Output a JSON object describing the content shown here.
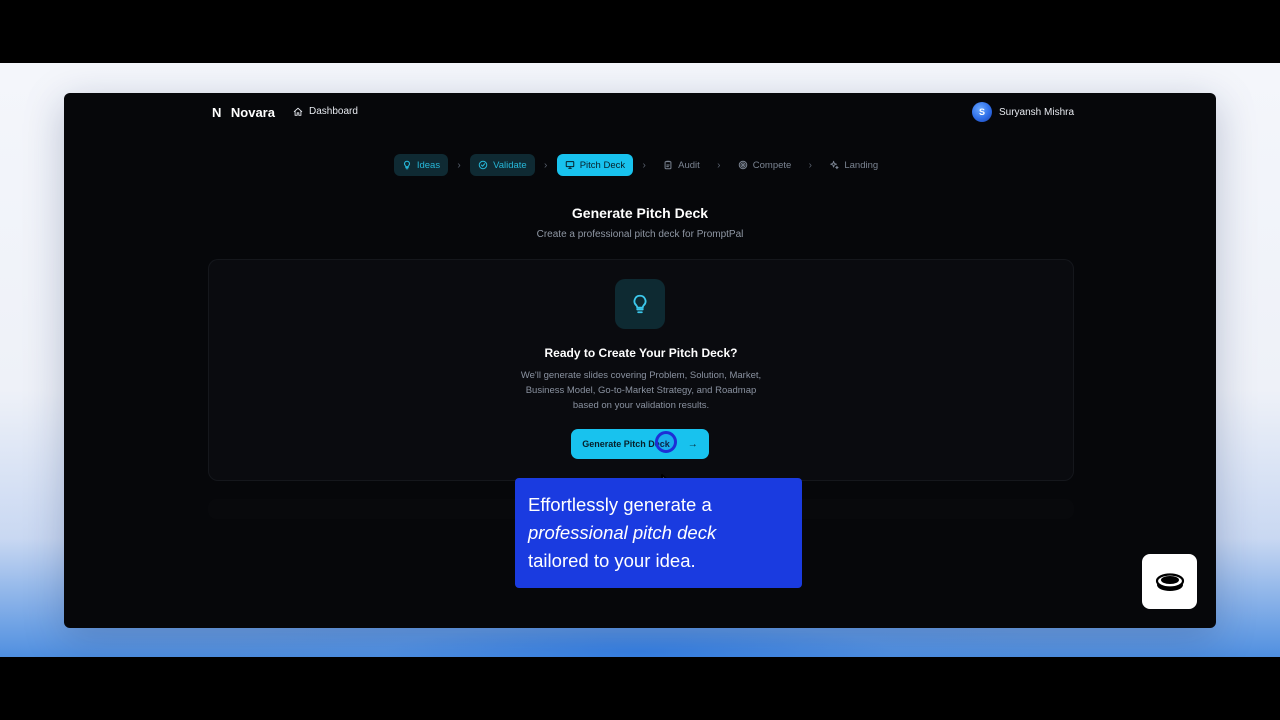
{
  "app": {
    "brand_mark": "N",
    "brand_name": "Novara",
    "nav_dashboard": "Dashboard"
  },
  "user": {
    "initial": "S",
    "name": "Suryansh Mishra"
  },
  "stepper": [
    {
      "label": "Ideas",
      "state": "done",
      "icon": "lightbulb-icon"
    },
    {
      "label": "Validate",
      "state": "done",
      "icon": "check-circle-icon"
    },
    {
      "label": "Pitch Deck",
      "state": "active",
      "icon": "presentation-icon"
    },
    {
      "label": "Audit",
      "state": "pending",
      "icon": "clipboard-icon"
    },
    {
      "label": "Compete",
      "state": "pending",
      "icon": "target-icon"
    },
    {
      "label": "Landing",
      "state": "pending",
      "icon": "sparkles-icon"
    }
  ],
  "page": {
    "title": "Generate Pitch Deck",
    "subtitle": "Create a professional pitch deck for PromptPal"
  },
  "card": {
    "icon": "lightbulb-icon",
    "title": "Ready to Create Your Pitch Deck?",
    "description_lines": [
      "We'll generate slides covering Problem, Solution, Market,",
      "Business Model, Go-to-Market Strategy, and Roadmap",
      "based on your validation results."
    ],
    "cta_label": "Generate Pitch Deck",
    "cta_icon": "arrow-right-icon"
  },
  "tooltip": {
    "line1": "Effortlessly generate a",
    "line2": "professional pitch deck",
    "line3": "tailored to your idea."
  },
  "colors": {
    "accent": "#18c2ee",
    "tooltip_bg": "#1a3be0",
    "window_bg": "#06070a"
  }
}
